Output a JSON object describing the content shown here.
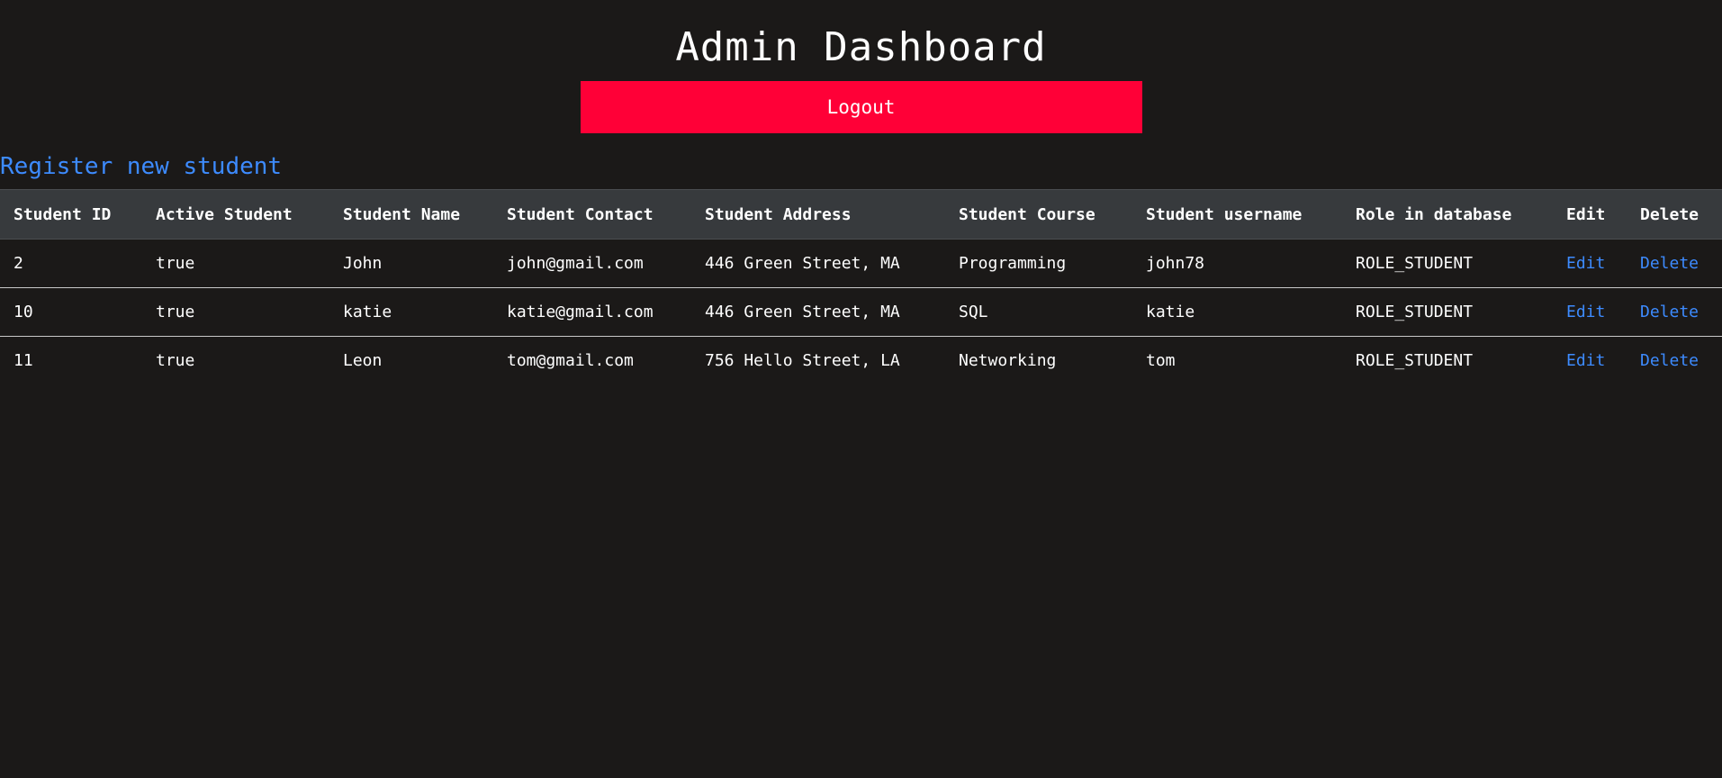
{
  "header": {
    "title": "Admin Dashboard",
    "logout_label": "Logout"
  },
  "register_link": "Register new student",
  "colors": {
    "background": "#1b1918",
    "logout_button": "#ff0037",
    "link": "#3d8bff",
    "table_header": "#373a3d"
  },
  "table": {
    "columns": [
      "Student ID",
      "Active Student",
      "Student Name",
      "Student Contact",
      "Student Address",
      "Student Course",
      "Student username",
      "Role in database",
      "Edit",
      "Delete"
    ],
    "rows": [
      {
        "id": "2",
        "active": "true",
        "name": "John",
        "contact": "john@gmail.com",
        "address": "446 Green Street, MA",
        "course": "Programming",
        "username": "john78",
        "role": "ROLE_STUDENT",
        "edit": "Edit",
        "delete": "Delete"
      },
      {
        "id": "10",
        "active": "true",
        "name": "katie",
        "contact": "katie@gmail.com",
        "address": "446 Green Street, MA",
        "course": "SQL",
        "username": "katie",
        "role": "ROLE_STUDENT",
        "edit": "Edit",
        "delete": "Delete"
      },
      {
        "id": "11",
        "active": "true",
        "name": "Leon",
        "contact": "tom@gmail.com",
        "address": "756 Hello Street, LA",
        "course": "Networking",
        "username": "tom",
        "role": "ROLE_STUDENT",
        "edit": "Edit",
        "delete": "Delete"
      }
    ]
  }
}
